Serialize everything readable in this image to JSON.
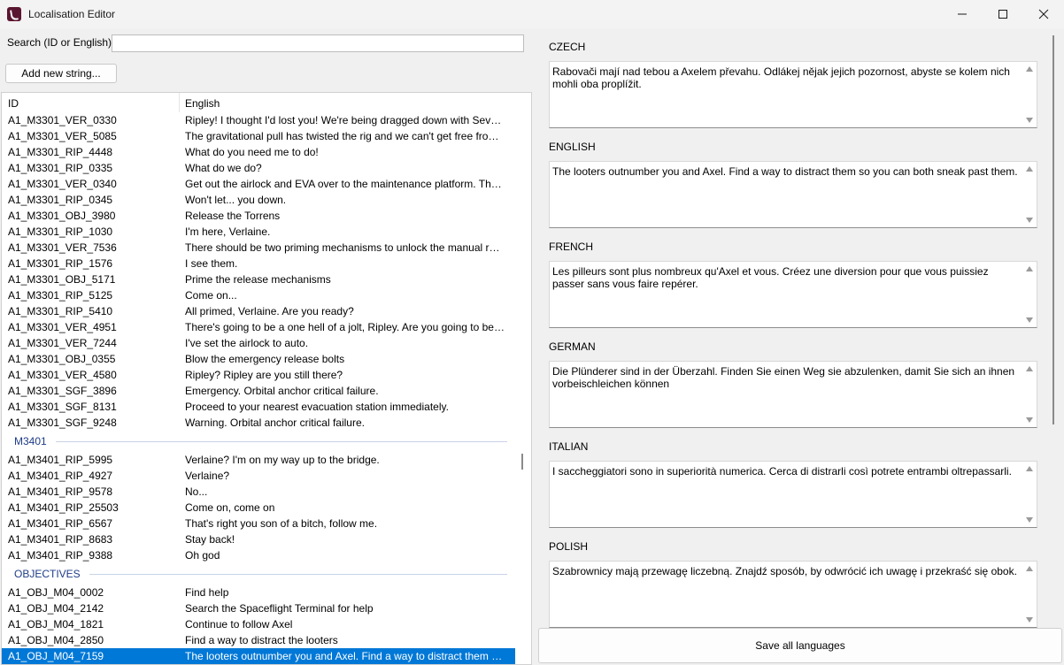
{
  "window": {
    "title": "Localisation Editor"
  },
  "search": {
    "label": "Search (ID or English):",
    "value": ""
  },
  "add_button_label": "Add new string...",
  "list": {
    "columns": [
      "ID",
      "English"
    ],
    "rows": [
      {
        "id": "A1_M3301_VER_0330",
        "en": "Ripley! I thought I'd lost you! We're being dragged down with Sevastopol!"
      },
      {
        "id": "A1_M3301_VER_5085",
        "en": "The gravitational pull has twisted the rig and we can't get free from the stati..."
      },
      {
        "id": "A1_M3301_RIP_4448",
        "en": "What do you need me to do!"
      },
      {
        "id": "A1_M3301_RIP_0335",
        "en": "What do we do?"
      },
      {
        "id": "A1_M3301_VER_0340",
        "en": "Get out the airlock and EVA over to the maintenance platform. There are e..."
      },
      {
        "id": "A1_M3301_RIP_0345",
        "en": "Won't let... you down."
      },
      {
        "id": "A1_M3301_OBJ_3980",
        "en": "Release the Torrens"
      },
      {
        "id": "A1_M3301_RIP_1030",
        "en": "I'm here, Verlaine."
      },
      {
        "id": "A1_M3301_VER_7536",
        "en": "There should be two priming mechanisms to unlock the manual release."
      },
      {
        "id": "A1_M3301_RIP_1576",
        "en": "I see them."
      },
      {
        "id": "A1_M3301_OBJ_5171",
        "en": "Prime the release mechanisms"
      },
      {
        "id": "A1_M3301_RIP_5125",
        "en": "Come on..."
      },
      {
        "id": "A1_M3301_RIP_5410",
        "en": "All primed, Verlaine. Are you ready?"
      },
      {
        "id": "A1_M3301_VER_4951",
        "en": "There's going to be a one hell of a jolt, Ripley. Are you going to be able to ..."
      },
      {
        "id": "A1_M3301_VER_7244",
        "en": "I've set the airlock to auto."
      },
      {
        "id": "A1_M3301_OBJ_0355",
        "en": "Blow the emergency release bolts"
      },
      {
        "id": "A1_M3301_VER_4580",
        "en": "Ripley? Ripley are you still there?"
      },
      {
        "id": "A1_M3301_SGF_3896",
        "en": "Emergency. Orbital anchor critical failure."
      },
      {
        "id": "A1_M3301_SGF_8131",
        "en": "Proceed to your nearest evacuation station immediately."
      },
      {
        "id": "A1_M3301_SGF_9248",
        "en": "Warning. Orbital anchor critical failure."
      },
      {
        "group": "M3401"
      },
      {
        "id": "A1_M3401_RIP_5995",
        "en": "Verlaine? I'm on my way up to the bridge."
      },
      {
        "id": "A1_M3401_RIP_4927",
        "en": "Verlaine?"
      },
      {
        "id": "A1_M3401_RIP_9578",
        "en": "No..."
      },
      {
        "id": "A1_M3401_RIP_25503",
        "en": "Come on, come on"
      },
      {
        "id": "A1_M3401_RIP_6567",
        "en": "That's right you son of a bitch, follow me."
      },
      {
        "id": "A1_M3401_RIP_8683",
        "en": "Stay back!"
      },
      {
        "id": "A1_M3401_RIP_9388",
        "en": "Oh god"
      },
      {
        "group": "OBJECTIVES"
      },
      {
        "id": "A1_OBJ_M04_0002",
        "en": "Find help"
      },
      {
        "id": "A1_OBJ_M04_2142",
        "en": "Search the Spaceflight Terminal for help"
      },
      {
        "id": "A1_OBJ_M04_1821",
        "en": "Continue to follow Axel"
      },
      {
        "id": "A1_OBJ_M04_2850",
        "en": "Find a way to distract the looters"
      },
      {
        "id": "A1_OBJ_M04_7159",
        "en": "The looters outnumber you and Axel. Find a way to distract them so you ca...",
        "selected": true
      }
    ]
  },
  "languages": [
    {
      "name": "CZECH",
      "text": "Rabovači mají nad tebou a Axelem převahu. Odlákej nějak jejich pozornost, abyste se kolem nich mohli oba proplížit."
    },
    {
      "name": "ENGLISH",
      "text": "The looters outnumber you and Axel. Find a way to distract them so you can both sneak past them."
    },
    {
      "name": "FRENCH",
      "text": "Les pilleurs sont plus nombreux qu'Axel et vous. Créez une diversion pour que vous puissiez passer sans vous faire repérer."
    },
    {
      "name": "GERMAN",
      "text": "Die Plünderer sind in der Überzahl. Finden Sie einen Weg sie abzulenken, damit Sie sich an ihnen vorbeischleichen können"
    },
    {
      "name": "ITALIAN",
      "text": "I saccheggiatori sono in superiorità numerica. Cerca di distrarli così potrete entrambi oltrepassarli."
    },
    {
      "name": "POLISH",
      "text": "Szabrownicy mają przewagę liczebną. Znajdź sposób, by odwrócić ich uwagę i przekraść się obok."
    }
  ],
  "save_button_label": "Save all languages",
  "icons": {
    "app": "app-logo-icon",
    "minimize": "minimize-icon",
    "maximize": "maximize-icon",
    "close": "close-icon"
  },
  "colors": {
    "selection": "#0078d7",
    "group_label": "#1f3c88"
  }
}
